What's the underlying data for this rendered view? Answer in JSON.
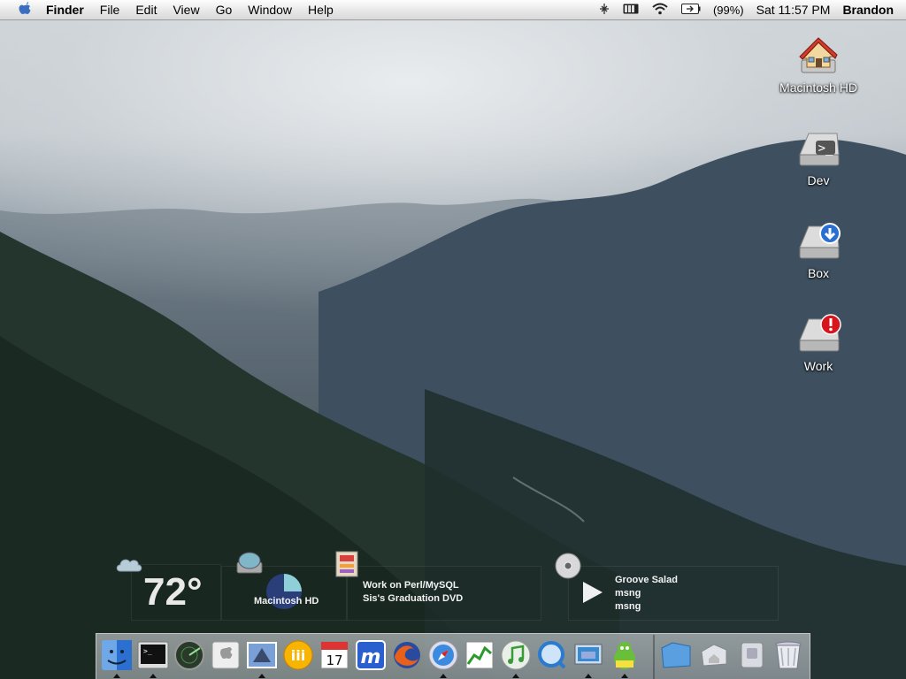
{
  "menubar": {
    "app_name": "Finder",
    "menus": [
      "File",
      "Edit",
      "View",
      "Go",
      "Window",
      "Help"
    ],
    "battery_percent": "(99%)",
    "clock": "Sat 11:57 PM",
    "user": "Brandon"
  },
  "desktop_icons": [
    {
      "label": "Macintosh HD",
      "icon": "house-drive-icon"
    },
    {
      "label": "Dev",
      "icon": "drive-icon"
    },
    {
      "label": "Box",
      "icon": "drive-icon"
    },
    {
      "label": "Work",
      "icon": "drive-icon"
    }
  ],
  "widgets": {
    "weather": {
      "temperature": "72°",
      "icon": "cloud-icon"
    },
    "disk": {
      "label": "Macintosh HD",
      "used_fraction": 0.75
    },
    "stickies": {
      "line1": "Work on Perl/MySQL",
      "line2": "Sis's Graduation DVD"
    },
    "radio": {
      "station": "Groove Salad",
      "line2": "msng",
      "line3": "msng"
    }
  },
  "dock": {
    "items": [
      "finder-icon",
      "terminal-icon",
      "network-radar-icon",
      "apple-preview-icon",
      "mail-icon",
      "fire-app-icon",
      "ical-icon",
      "mail-app-icon",
      "firefox-icon",
      "safari-icon",
      "activity-icon",
      "itunes-icon",
      "quicktime-icon",
      "system-icon",
      "adium-icon",
      "folder-icon",
      "home-folder-icon",
      "app-folder-icon",
      "trash-icon"
    ],
    "running": [
      "finder-icon",
      "terminal-icon",
      "mail-icon",
      "safari-icon",
      "itunes-icon",
      "system-icon",
      "adium-icon"
    ]
  },
  "colors": {
    "menubar_bg": "#e6e6e6",
    "dock_bg": "#dfe2e6",
    "text_white": "#ffffff"
  }
}
